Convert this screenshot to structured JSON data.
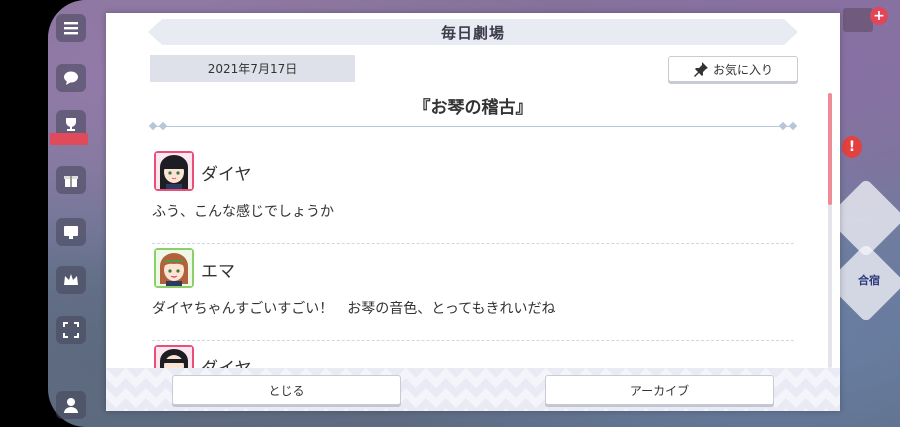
{
  "dialog": {
    "title": "毎日劇場",
    "date": "2021年7月17日",
    "favorite_label": "お気に入り",
    "episode_title": "『お琴の稽古』",
    "entries": [
      {
        "speaker": "ダイヤ",
        "text": "ふう、こんな感じでしょうか",
        "avatar_color": "#e8507a"
      },
      {
        "speaker": "エマ",
        "text": "ダイヤちゃんすごいすごい！　お琴の音色、とってもきれいだね",
        "avatar_color": "#8ccf6a"
      },
      {
        "speaker": "ダイヤ",
        "text": "",
        "avatar_color": "#e8507a"
      }
    ],
    "close_label": "とじる",
    "archive_label": "アーカイブ"
  },
  "right_panel": {
    "tile_label": "合宿"
  },
  "colors": {
    "scroll_thumb": "#f08a96",
    "accent_pink": "#e8507a",
    "accent_green": "#8ccf6a"
  },
  "icons": {
    "favorite": "pin-icon",
    "menu": "hamburger-icon"
  }
}
